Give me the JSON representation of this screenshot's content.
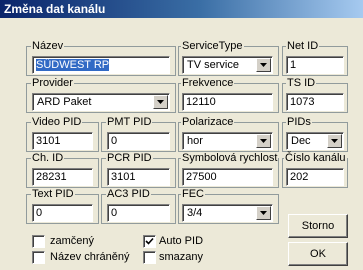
{
  "window": {
    "title": "Změna dat kanálu"
  },
  "fields": {
    "nazev": {
      "label": "Název",
      "value": "SÜDWEST RP"
    },
    "service_type": {
      "label": "ServiceType",
      "value": "TV service"
    },
    "net_id": {
      "label": "Net ID",
      "value": "1"
    },
    "provider": {
      "label": "Provider",
      "value": "ARD Paket"
    },
    "frekvence": {
      "label": "Frekvence",
      "value": "12110"
    },
    "ts_id": {
      "label": "TS ID",
      "value": "1073"
    },
    "video_pid": {
      "label": "Video PID",
      "value": "3101"
    },
    "pmt_pid": {
      "label": "PMT PID",
      "value": "0"
    },
    "polarizace": {
      "label": "Polarizace",
      "value": "hor"
    },
    "pids": {
      "label": "PIDs",
      "value": "Dec"
    },
    "ch_id": {
      "label": "Ch. ID",
      "value": "28231"
    },
    "pcr_pid": {
      "label": "PCR PID",
      "value": "3101"
    },
    "symbolova": {
      "label": "Symbolová rychlost",
      "value": "27500"
    },
    "cislo_kanalu": {
      "label": "Číslo kanálu",
      "value": "202"
    },
    "text_pid": {
      "label": "Text PID",
      "value": "0"
    },
    "ac3_pid": {
      "label": "AC3 PID",
      "value": "0"
    },
    "fec": {
      "label": "FEC",
      "value": "3/4"
    }
  },
  "checkboxes": {
    "zamceny": {
      "label": "zamčený",
      "checked": false
    },
    "auto_pid": {
      "label": "Auto PID",
      "checked": true
    },
    "nazev_chraneny": {
      "label": "Název chráněný",
      "checked": false
    },
    "smazany": {
      "label": "smazany",
      "checked": false
    }
  },
  "buttons": {
    "storno": "Storno",
    "ok": "OK"
  },
  "icons": {
    "dropdown": "chevron-down-icon",
    "check": "checkmark-icon"
  }
}
